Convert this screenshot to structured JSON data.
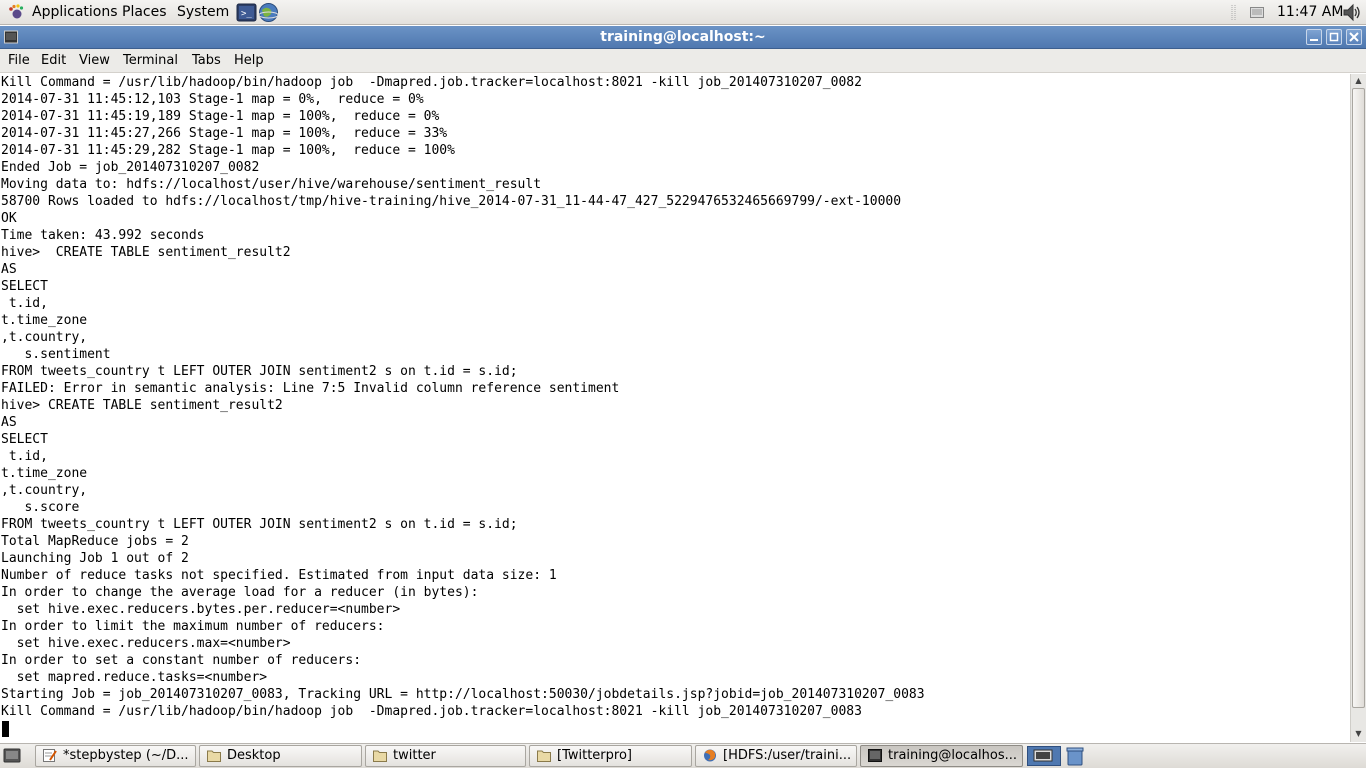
{
  "top_panel": {
    "menus": [
      "Applications",
      "Places",
      "System"
    ],
    "clock": "11:47 AM"
  },
  "window": {
    "title": "training@localhost:~"
  },
  "menubar": [
    "File",
    "Edit",
    "View",
    "Terminal",
    "Tabs",
    "Help"
  ],
  "terminal": {
    "lines": [
      "Kill Command = /usr/lib/hadoop/bin/hadoop job  -Dmapred.job.tracker=localhost:8021 -kill job_201407310207_0082",
      "2014-07-31 11:45:12,103 Stage-1 map = 0%,  reduce = 0%",
      "2014-07-31 11:45:19,189 Stage-1 map = 100%,  reduce = 0%",
      "2014-07-31 11:45:27,266 Stage-1 map = 100%,  reduce = 33%",
      "2014-07-31 11:45:29,282 Stage-1 map = 100%,  reduce = 100%",
      "Ended Job = job_201407310207_0082",
      "Moving data to: hdfs://localhost/user/hive/warehouse/sentiment_result",
      "58700 Rows loaded to hdfs://localhost/tmp/hive-training/hive_2014-07-31_11-44-47_427_5229476532465669799/-ext-10000",
      "OK",
      "Time taken: 43.992 seconds",
      "hive>  CREATE TABLE sentiment_result2",
      "AS",
      "SELECT",
      " t.id,",
      "t.time_zone",
      ",t.country,",
      "   s.sentiment",
      "FROM tweets_country t LEFT OUTER JOIN sentiment2 s on t.id = s.id;",
      "FAILED: Error in semantic analysis: Line 7:5 Invalid column reference sentiment",
      "hive> CREATE TABLE sentiment_result2",
      "AS",
      "SELECT",
      " t.id,",
      "t.time_zone",
      ",t.country,",
      "   s.score",
      "FROM tweets_country t LEFT OUTER JOIN sentiment2 s on t.id = s.id;",
      "Total MapReduce jobs = 2",
      "Launching Job 1 out of 2",
      "Number of reduce tasks not specified. Estimated from input data size: 1",
      "In order to change the average load for a reducer (in bytes):",
      "  set hive.exec.reducers.bytes.per.reducer=<number>",
      "In order to limit the maximum number of reducers:",
      "  set hive.exec.reducers.max=<number>",
      "In order to set a constant number of reducers:",
      "  set mapred.reduce.tasks=<number>",
      "Starting Job = job_201407310207_0083, Tracking URL = http://localhost:50030/jobdetails.jsp?jobid=job_201407310207_0083",
      "Kill Command = /usr/lib/hadoop/bin/hadoop job  -Dmapred.job.tracker=localhost:8021 -kill job_201407310207_0083"
    ]
  },
  "taskbar": {
    "tasks": [
      {
        "label": "*stepbystep (~/D...",
        "icon": "text-editor-icon"
      },
      {
        "label": "Desktop",
        "icon": "folder-icon"
      },
      {
        "label": "twitter",
        "icon": "folder-icon"
      },
      {
        "label": "[Twitterpro]",
        "icon": "folder-icon"
      },
      {
        "label": "[HDFS:/user/traini...",
        "icon": "firefox-icon"
      },
      {
        "label": "training@localhos...",
        "icon": "terminal-icon"
      }
    ]
  },
  "colors": {
    "titlebar": "#5a83bb",
    "panel": "#e9e8e5",
    "terminal_bg": "#ffffff",
    "terminal_fg": "#000000"
  }
}
